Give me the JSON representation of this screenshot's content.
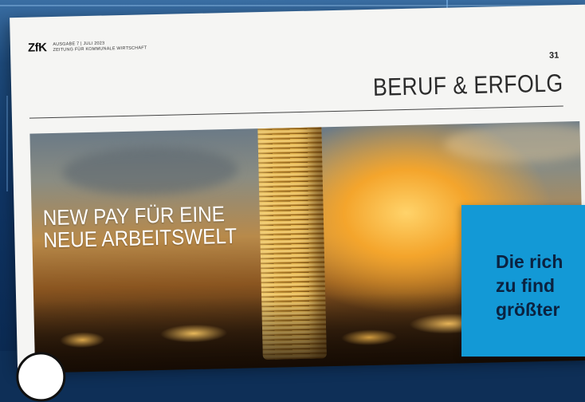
{
  "masthead": {
    "logo": "ZfK",
    "issue_line": "AUSGABE 7 | JULI 2023",
    "publication": "ZEITUNG FÜR KOMMUNALE WIRTSCHAFT"
  },
  "page_number": "31",
  "section_title": "BERUF & ERFOLG",
  "hero": {
    "headline_line1": "NEW PAY FÜR EINE",
    "headline_line2": "NEUE ARBEITSWELT"
  },
  "callout": {
    "line1": "Die rich",
    "line2": "zu find",
    "line3": "größter"
  },
  "colors": {
    "background": "#0e2f57",
    "page": "#f5f5f3",
    "callout": "#1399d6",
    "callout_text": "#0b2240"
  }
}
